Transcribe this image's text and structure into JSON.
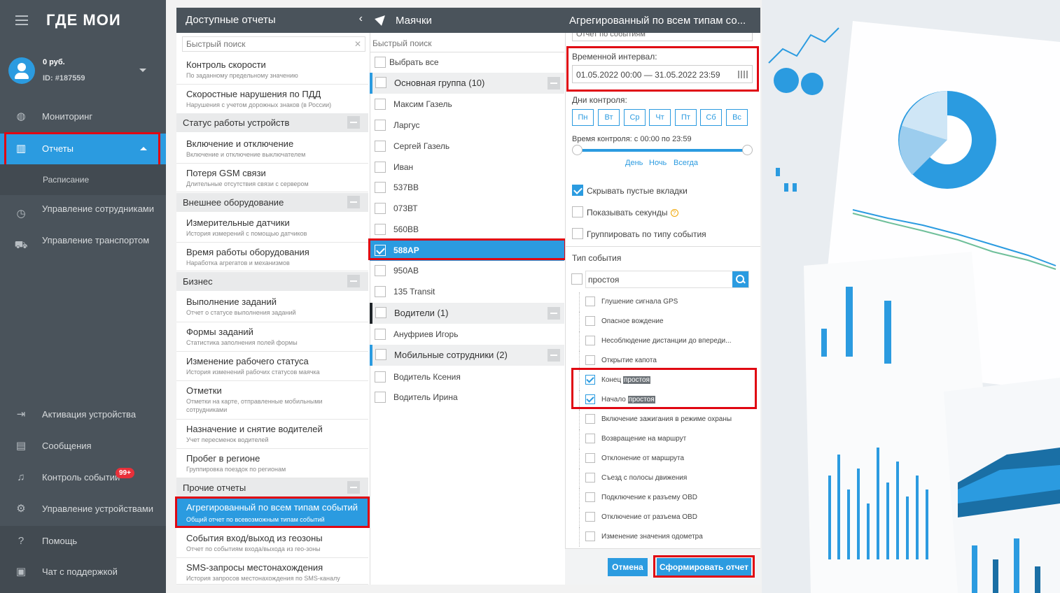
{
  "sidebar": {
    "logo": "ГДЕ МОИ",
    "balance": "0 руб.",
    "user_id": "ID: #187559",
    "items": [
      {
        "label": "Мониторинг"
      },
      {
        "label": "Отчеты"
      },
      {
        "label": "Расписание"
      },
      {
        "label": "Управление сотрудниками"
      },
      {
        "label": "Управление транспортом"
      },
      {
        "label": "Активация устройства"
      },
      {
        "label": "Сообщения"
      },
      {
        "label": "Контроль событий"
      },
      {
        "label": "Управление устройствами"
      },
      {
        "label": "Помощь"
      },
      {
        "label": "Чат с поддержкой"
      }
    ],
    "events_badge": "99+"
  },
  "reports": {
    "title": "Доступные отчеты",
    "search_placeholder": "Быстрый поиск",
    "items": [
      {
        "title": "Контроль скорости",
        "sub": "По заданному предельному значению"
      },
      {
        "title": "Скоростные нарушения по ПДД",
        "sub": "Нарушения с учетом дорожных знаков (в России)"
      },
      {
        "title": "Включение и отключение",
        "sub": "Включение и отключение выключателем"
      },
      {
        "title": "Потеря GSM связи",
        "sub": "Длительные отсутствия связи с сервером"
      },
      {
        "title": "Измерительные датчики",
        "sub": "История измерений с помощью датчиков"
      },
      {
        "title": "Время работы оборудования",
        "sub": "Наработка агрегатов и механизмов"
      },
      {
        "title": "Выполнение заданий",
        "sub": "Отчет о статусе выполнения заданий"
      },
      {
        "title": "Формы заданий",
        "sub": "Статистика заполнения полей формы"
      },
      {
        "title": "Изменение рабочего статуса",
        "sub": "История изменений рабочих статусов маячка"
      },
      {
        "title": "Отметки",
        "sub": "Отметки на карте, отправленные мобильными сотрудниками"
      },
      {
        "title": "Назначение и снятие водителей",
        "sub": "Учет пересменок водителей"
      },
      {
        "title": "Пробег в регионе",
        "sub": "Группировка поездок по регионам"
      },
      {
        "title": "Агрегированный по всем типам событий",
        "sub": "Общий отчет по всевозможным типам событий"
      },
      {
        "title": "События вход/выход из геозоны",
        "sub": "Отчет по событиям входа/выхода из гео-зоны"
      },
      {
        "title": "SMS-запросы местонахождения",
        "sub": "История запросов местонахождения по SMS-каналу"
      }
    ],
    "categories": [
      "Статус работы устройств",
      "Внешнее оборудование",
      "Бизнес",
      "Прочие отчеты"
    ]
  },
  "trackers": {
    "title": "Маячки",
    "search_placeholder": "Быстрый поиск",
    "select_all": "Выбрать все",
    "groups": [
      "Основная группа (10)",
      "Водители (1)",
      "Мобильные сотрудники (2)"
    ],
    "items": [
      "Максим Газель",
      "Ларгус",
      "Сергей Газель",
      "Иван",
      "537ВВ",
      "073ВТ",
      "560ВВ",
      "588АР",
      "950АВ",
      "135 Transit",
      "Ануфриев Игорь",
      "Водитель Ксения",
      "Водитель Ирина"
    ]
  },
  "settings": {
    "title": "Агрегированный по всем типам со...",
    "top_field": "Отчет по событиям",
    "interval_label": "Временной интервал:",
    "interval_value": "01.05.2022 00:00 — 31.05.2022 23:59",
    "days_label": "Дни контроля:",
    "days": [
      "Пн",
      "Вт",
      "Ср",
      "Чт",
      "Пт",
      "Сб",
      "Вс"
    ],
    "time_label": "Время контроля: с 00:00 по 23:59",
    "links": [
      "День",
      "Ночь",
      "Всегда"
    ],
    "options": [
      {
        "label": "Скрывать пустые вкладки",
        "checked": true
      },
      {
        "label": "Показывать секунды",
        "checked": false
      },
      {
        "label": "Группировать по типу события",
        "checked": false
      }
    ],
    "event_type_label": "Тип события",
    "event_search_value": "простоя",
    "events": [
      {
        "label": "Глушение сигнала GPS",
        "checked": false
      },
      {
        "label": "Опасное вождение",
        "checked": false
      },
      {
        "label": "Несоблюдение дистанции до впереди...",
        "checked": false
      },
      {
        "label": "Открытие капота",
        "checked": false
      },
      {
        "label_pre": "Конец ",
        "label_hl": "простоя",
        "checked": true
      },
      {
        "label_pre": "Начало ",
        "label_hl": "простоя",
        "checked": true
      },
      {
        "label": "Включение зажигания в режиме охраны",
        "checked": false
      },
      {
        "label": "Возвращение на маршрут",
        "checked": false
      },
      {
        "label": "Отклонение от маршрута",
        "checked": false
      },
      {
        "label": "Съезд с полосы движения",
        "checked": false
      },
      {
        "label": "Подключение к разъему OBD",
        "checked": false
      },
      {
        "label": "Отключение от разъема OBD",
        "checked": false
      },
      {
        "label": "Изменение значения одометра",
        "checked": false
      }
    ],
    "cancel_label": "Отмена",
    "submit_label": "Сформировать отчет"
  },
  "colors": {
    "accent": "#2b9be0",
    "sidebar": "#4a535b",
    "highlight": "#e00712"
  }
}
